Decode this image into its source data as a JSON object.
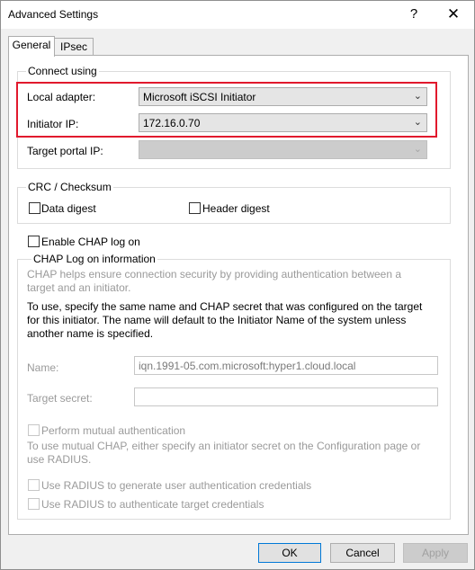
{
  "window": {
    "title": "Advanced Settings",
    "help_glyph": "?",
    "close_glyph": "✕"
  },
  "tabs": [
    {
      "label": "General"
    },
    {
      "label": "IPsec"
    }
  ],
  "connect_using": {
    "title": "Connect using",
    "local_adapter": {
      "label": "Local adapter:",
      "value": "Microsoft iSCSI Initiator"
    },
    "initiator_ip": {
      "label": "Initiator IP:",
      "value": "172.16.0.70"
    },
    "target_portal_ip": {
      "label": "Target portal IP:",
      "value": ""
    }
  },
  "crc": {
    "title": "CRC / Checksum",
    "data_digest": {
      "label": "Data digest"
    },
    "header_digest": {
      "label": "Header digest"
    }
  },
  "chap": {
    "enable_label": "Enable CHAP log on",
    "group_title": "CHAP Log on information",
    "help_text": "CHAP helps ensure connection security by providing authentication between a target and an initiator.",
    "instructions": "To use, specify the same name and CHAP secret that was configured on the target for this initiator.  The name will default to the Initiator Name of the system unless another name is specified.",
    "name_label": "Name:",
    "name_value": "iqn.1991-05.com.microsoft:hyper1.cloud.local",
    "secret_label": "Target secret:",
    "mutual_label": "Perform mutual authentication",
    "mutual_text": "To use mutual CHAP, either specify an initiator secret on the Configuration page or use RADIUS.",
    "radius_user_label": "Use RADIUS to generate user authentication credentials",
    "radius_target_label": "Use RADIUS to authenticate target credentials"
  },
  "buttons": {
    "ok": "OK",
    "cancel": "Cancel",
    "apply": "Apply"
  }
}
